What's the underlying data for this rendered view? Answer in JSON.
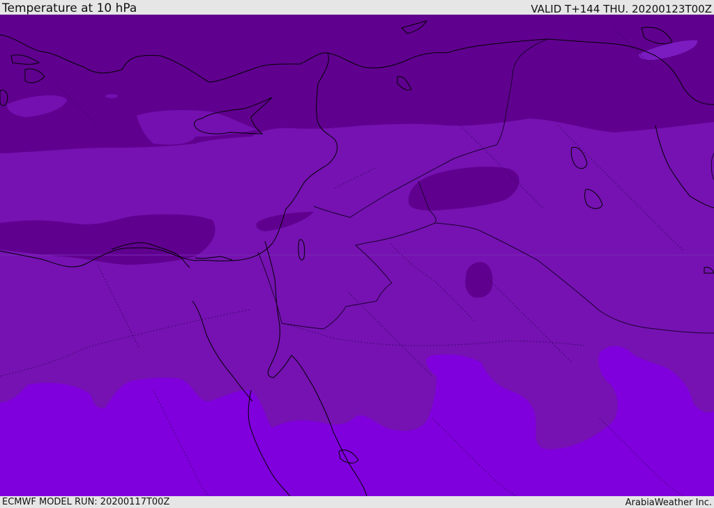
{
  "header": {
    "title": "Temperature at 10 hPa",
    "valid_time": "VALID T+144 THU. 20200123T00Z"
  },
  "footer": {
    "model_run": "ECMWF MODEL RUN: 20200117T00Z",
    "credit": "ArabiaWeather Inc."
  },
  "map": {
    "colors": {
      "coldest": "#5f0096",
      "cold": "#7410b0",
      "mid": "#7a14b4",
      "warm": "#7f00dc",
      "coastline": "#000000",
      "border": "#1a0030"
    }
  }
}
